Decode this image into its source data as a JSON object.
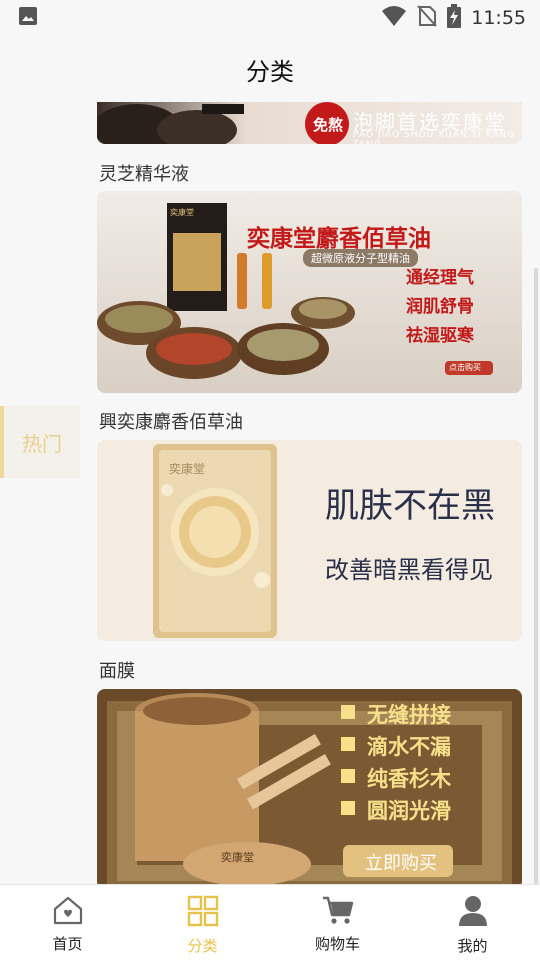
{
  "status_bar": {
    "time": "11:55"
  },
  "header": {
    "title": "分类"
  },
  "left_rail": {
    "items": [
      {
        "label": "热门"
      }
    ]
  },
  "content": {
    "top_banner": {
      "badge": "免熬",
      "text": "泡脚首选奕康堂",
      "pinyin": "PAO JIAO SHOU XUAN YI KANG TANG"
    },
    "sections": [
      {
        "title": "灵芝精华液",
        "banner": {
          "headline": "奕康堂麝香佰草油",
          "subhead": "超微原液分子型精油",
          "features": [
            "通经理气",
            "润肌舒骨",
            "祛湿驱寒"
          ],
          "button": "点击购买",
          "box_brand": "奕康堂"
        }
      },
      {
        "title": "興奕康麝香佰草油",
        "banner": {
          "headline": "肌肤不在黑",
          "subhead": "改善暗黑看得见",
          "pack_brand": "奕康堂"
        }
      },
      {
        "title": "面膜",
        "banner": {
          "features": [
            "无缝拼接",
            "滴水不漏",
            "纯香杉木",
            "圆润光滑"
          ],
          "button": "立即购买",
          "lid_brand": "奕康堂"
        }
      }
    ]
  },
  "bottom_nav": {
    "items": [
      {
        "label": "首页",
        "icon": "home-icon"
      },
      {
        "label": "分类",
        "icon": "grid-icon"
      },
      {
        "label": "购物车",
        "icon": "cart-icon"
      },
      {
        "label": "我的",
        "icon": "profile-icon"
      }
    ],
    "active": "分类"
  },
  "colors": {
    "accent": "#e7c24a",
    "rail_text": "#e9cf8f",
    "banner_red": "#c21a1a"
  }
}
